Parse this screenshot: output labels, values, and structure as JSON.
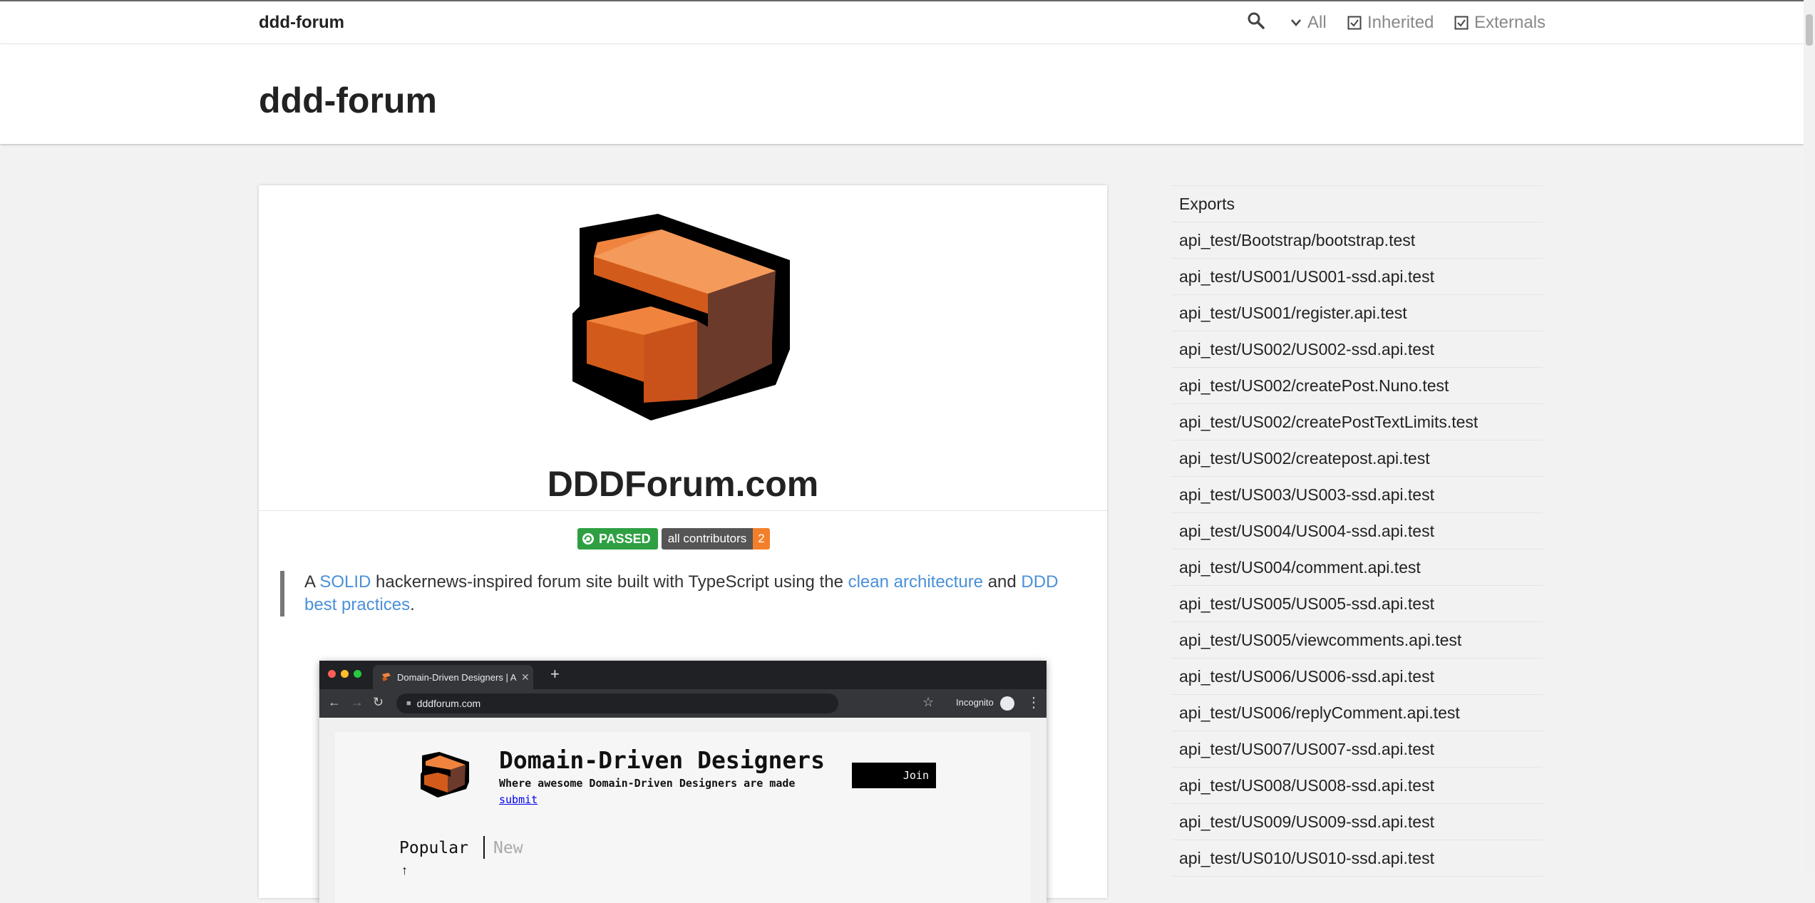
{
  "toolbar": {
    "brand": "ddd-forum",
    "options": [
      {
        "label": "All",
        "icon": "chevron-down-icon"
      },
      {
        "label": "Inherited",
        "icon": "checkbox-icon"
      },
      {
        "label": "Externals",
        "icon": "checkbox-icon"
      }
    ]
  },
  "header": {
    "title": "ddd-forum"
  },
  "readme": {
    "heading": "DDDForum.com",
    "badges": {
      "build": "PASSED",
      "contributors_label": "all contributors",
      "contributors_count": "2"
    },
    "description": {
      "prefix": "A ",
      "link_solid": "SOLID",
      "middle": " hackernews-inspired forum site built with TypeScript using the ",
      "link_clean": "clean architecture",
      "and": " and ",
      "link_ddd": "DDD best practices",
      "suffix": "."
    },
    "screenshot": {
      "tab_title": "Domain-Driven Designers | A ",
      "url": "dddforum.com",
      "incognito": "Incognito",
      "site_title": "Domain-Driven Designers",
      "site_subtitle": "Where awesome Domain-Driven Designers are made",
      "submit": "submit",
      "join": "Join",
      "tab_popular": "Popular",
      "tab_new": "New"
    }
  },
  "sidebar": {
    "heading": "Exports",
    "items": [
      "api_test/Bootstrap/bootstrap.test",
      "api_test/US001/US001-ssd.api.test",
      "api_test/US001/register.api.test",
      "api_test/US002/US002-ssd.api.test",
      "api_test/US002/createPost.Nuno.test",
      "api_test/US002/createPostTextLimits.test",
      "api_test/US002/createpost.api.test",
      "api_test/US003/US003-ssd.api.test",
      "api_test/US004/US004-ssd.api.test",
      "api_test/US004/comment.api.test",
      "api_test/US005/US005-ssd.api.test",
      "api_test/US005/viewcomments.api.test",
      "api_test/US006/US006-ssd.api.test",
      "api_test/US006/replyComment.api.test",
      "api_test/US007/US007-ssd.api.test",
      "api_test/US008/US008-ssd.api.test",
      "api_test/US009/US009-ssd.api.test",
      "api_test/US010/US010-ssd.api.test"
    ]
  },
  "colors": {
    "link": "#4a90d9",
    "badge_pass": "#2ea042",
    "badge_count": "#f2802b",
    "brick": "#f0843f"
  }
}
